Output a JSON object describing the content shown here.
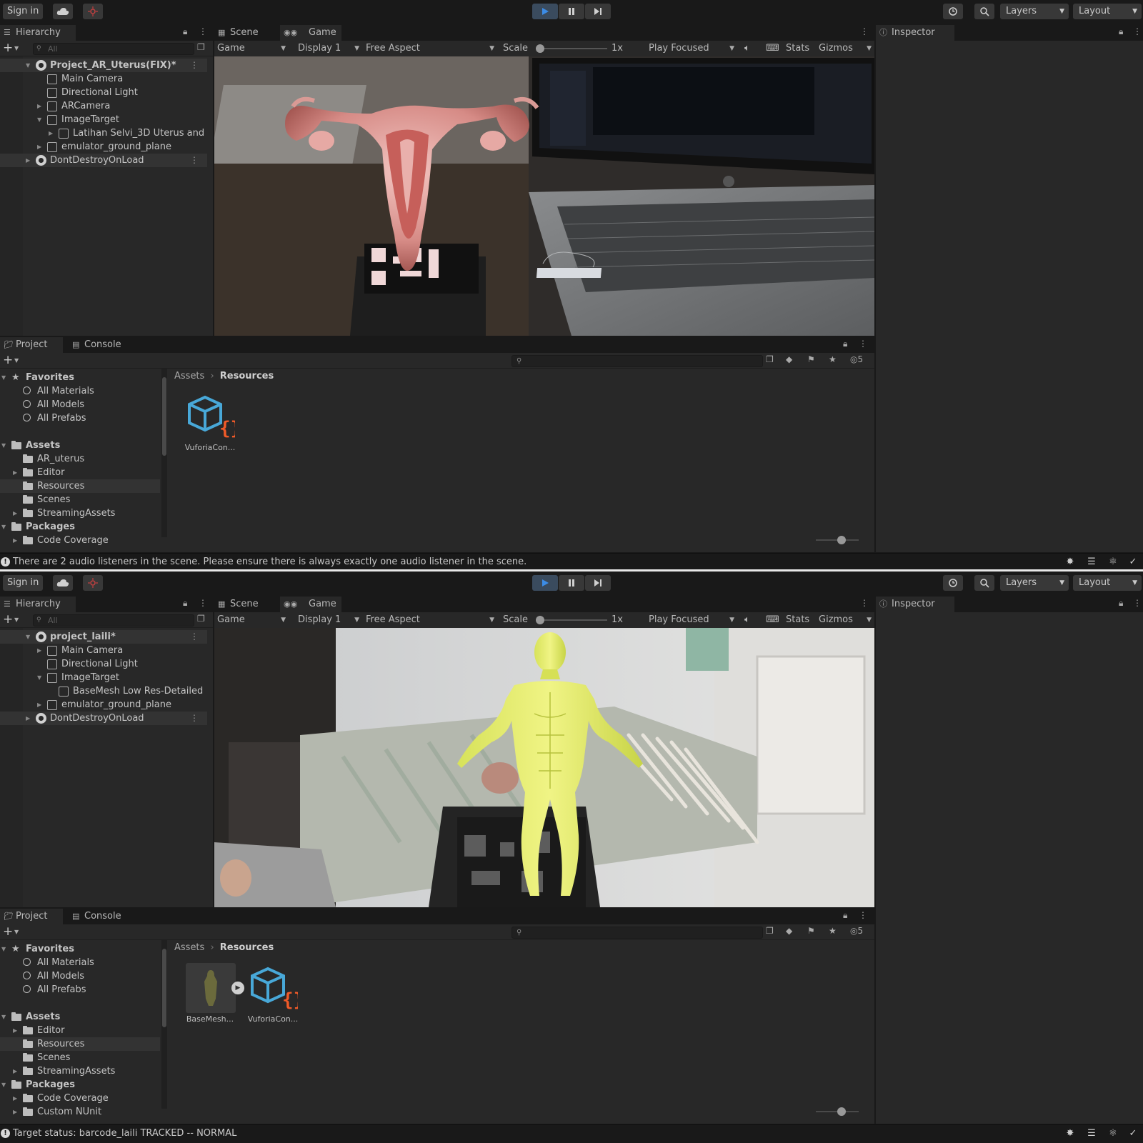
{
  "toolbar": {
    "sign_in": "Sign in",
    "layers": "Layers",
    "layout": "Layout"
  },
  "tabs": {
    "hierarchy": "Hierarchy",
    "scene": "Scene",
    "game": "Game",
    "inspector": "Inspector",
    "project": "Project",
    "console": "Console"
  },
  "gamebar": {
    "mode": "Game",
    "display": "Display 1",
    "aspect": "Free Aspect",
    "scale_label": "Scale",
    "scale_value": "1x",
    "play_focused": "Play Focused",
    "stats": "Stats",
    "gizmos": "Gizmos"
  },
  "search": {
    "placeholder": "All"
  },
  "breadcrumb": {
    "root": "Assets",
    "current": "Resources"
  },
  "colors": {
    "accent": "#3c8ce6",
    "background": "#191919",
    "panel": "#282828",
    "selection": "#333333"
  },
  "editor1": {
    "hierarchy": [
      {
        "label": "Project_AR_Uterus(FIX)*",
        "depth": 0,
        "icon": "unity-scene-icon",
        "expanded": true,
        "bold": true,
        "selected": true
      },
      {
        "label": "Main Camera",
        "depth": 1,
        "icon": "gameobject-icon"
      },
      {
        "label": "Directional Light",
        "depth": 1,
        "icon": "gameobject-icon"
      },
      {
        "label": "ARCamera",
        "depth": 1,
        "icon": "gameobject-icon",
        "collapsed": true
      },
      {
        "label": "ImageTarget",
        "depth": 1,
        "icon": "gameobject-icon",
        "expanded": true
      },
      {
        "label": "Latihan Selvi_3D Uterus and",
        "depth": 2,
        "icon": "gameobject-icon",
        "collapsed": true
      },
      {
        "label": "emulator_ground_plane",
        "depth": 1,
        "icon": "gameobject-icon",
        "collapsed": true
      },
      {
        "label": "DontDestroyOnLoad",
        "depth": 0,
        "icon": "unity-scene-icon",
        "collapsed": true,
        "selected": true
      }
    ],
    "project_tree": [
      {
        "label": "Favorites",
        "type": "star",
        "bold": true,
        "expanded": true
      },
      {
        "label": "All Materials",
        "type": "search",
        "depth": 1
      },
      {
        "label": "All Models",
        "type": "search",
        "depth": 1
      },
      {
        "label": "All Prefabs",
        "type": "search",
        "depth": 1
      },
      {
        "label": "",
        "type": "gap"
      },
      {
        "label": "Assets",
        "type": "folder",
        "bold": true,
        "expanded": true
      },
      {
        "label": "AR_uterus",
        "type": "folder",
        "depth": 1
      },
      {
        "label": "Editor",
        "type": "folder",
        "depth": 1,
        "collapsed": true
      },
      {
        "label": "Resources",
        "type": "folder",
        "depth": 1,
        "selected": true
      },
      {
        "label": "Scenes",
        "type": "folder",
        "depth": 1
      },
      {
        "label": "StreamingAssets",
        "type": "folder",
        "depth": 1,
        "collapsed": true
      },
      {
        "label": "Packages",
        "type": "folder",
        "bold": true,
        "expanded": true
      },
      {
        "label": "Code Coverage",
        "type": "folder",
        "depth": 1,
        "collapsed": true
      }
    ],
    "assets": [
      {
        "label": "VuforiaCon...",
        "kind": "vuforia-config-icon"
      }
    ],
    "status": "There are 2 audio listeners in the scene. Please ensure there is always exactly one audio listener in the scene."
  },
  "editor2": {
    "hierarchy": [
      {
        "label": "project_laili*",
        "depth": 0,
        "icon": "unity-scene-icon",
        "expanded": true,
        "bold": true,
        "selected": true
      },
      {
        "label": "Main Camera",
        "depth": 1,
        "icon": "gameobject-icon",
        "collapsed": true
      },
      {
        "label": "Directional Light",
        "depth": 1,
        "icon": "gameobject-icon"
      },
      {
        "label": "ImageTarget",
        "depth": 1,
        "icon": "gameobject-icon",
        "expanded": true
      },
      {
        "label": "BaseMesh Low Res-Detailed",
        "depth": 2,
        "icon": "gameobject-icon"
      },
      {
        "label": "emulator_ground_plane",
        "depth": 1,
        "icon": "gameobject-icon",
        "collapsed": true
      },
      {
        "label": "DontDestroyOnLoad",
        "depth": 0,
        "icon": "unity-scene-icon",
        "collapsed": true,
        "selected": true
      }
    ],
    "project_tree": [
      {
        "label": "Favorites",
        "type": "star",
        "bold": true,
        "expanded": true
      },
      {
        "label": "All Materials",
        "type": "search",
        "depth": 1
      },
      {
        "label": "All Models",
        "type": "search",
        "depth": 1
      },
      {
        "label": "All Prefabs",
        "type": "search",
        "depth": 1
      },
      {
        "label": "",
        "type": "gap"
      },
      {
        "label": "Assets",
        "type": "folder",
        "bold": true,
        "expanded": true
      },
      {
        "label": "Editor",
        "type": "folder",
        "depth": 1,
        "collapsed": true
      },
      {
        "label": "Resources",
        "type": "folder",
        "depth": 1,
        "selected": true
      },
      {
        "label": "Scenes",
        "type": "folder",
        "depth": 1
      },
      {
        "label": "StreamingAssets",
        "type": "folder",
        "depth": 1,
        "collapsed": true
      },
      {
        "label": "Packages",
        "type": "folder",
        "bold": true,
        "expanded": true
      },
      {
        "label": "Code Coverage",
        "type": "folder",
        "depth": 1,
        "collapsed": true
      },
      {
        "label": "Custom NUnit",
        "type": "folder",
        "depth": 1,
        "collapsed": true
      }
    ],
    "assets": [
      {
        "label": "BaseMesh...",
        "kind": "model-thumbnail"
      },
      {
        "label": "VuforiaCon...",
        "kind": "vuforia-config-icon"
      }
    ],
    "status": "Target status: barcode_laili TRACKED -- NORMAL"
  },
  "hidden_count": "5"
}
